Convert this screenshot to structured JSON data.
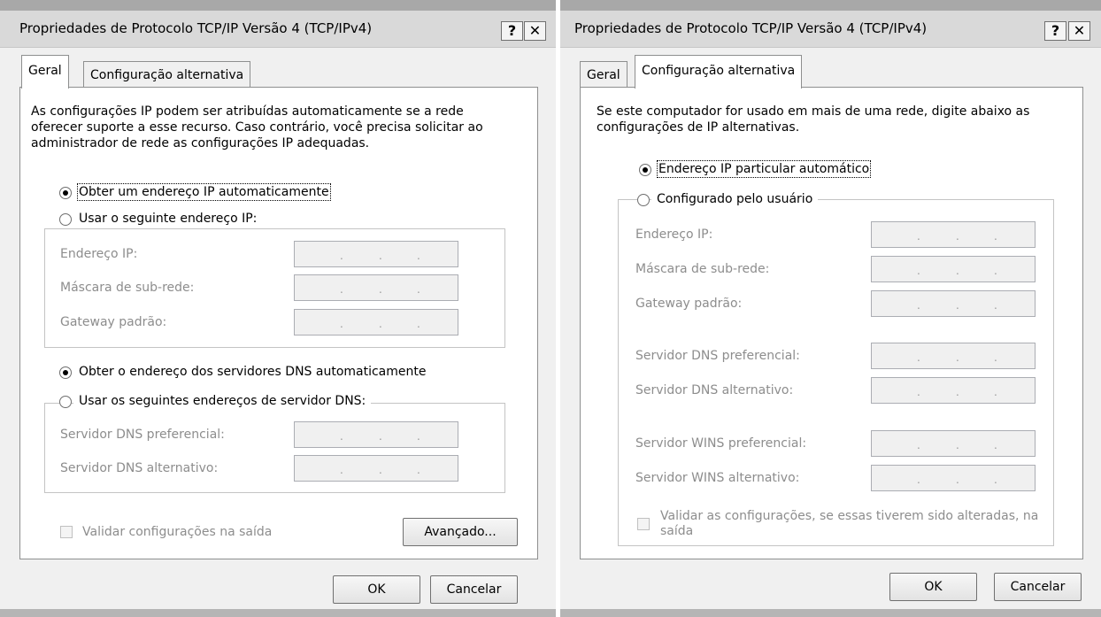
{
  "dialog_left": {
    "title": "Propriedades de Protocolo TCP/IP Versão 4 (TCP/IPv4)",
    "help_button": "?",
    "close_button": "✕",
    "tabs": [
      "Geral",
      "Configuração alternativa"
    ],
    "active_tab": "Geral",
    "intro": "As configurações IP podem ser atribuídas automaticamente se a rede oferecer suporte a esse recurso. Caso contrário, você precisa solicitar ao administrador de rede as configurações IP adequadas.",
    "radio_obtain_ip": "Obter um endereço IP automaticamente",
    "radio_use_ip": "Usar o seguinte endereço IP:",
    "ip_fields": [
      "Endereço IP:",
      "Máscara de sub-rede:",
      "Gateway padrão:"
    ],
    "radio_obtain_dns": "Obter o endereço dos servidores DNS automaticamente",
    "radio_use_dns": "Usar os seguintes endereços de servidor DNS:",
    "dns_fields": [
      "Servidor DNS preferencial:",
      "Servidor DNS alternativo:"
    ],
    "validate_checkbox": "Validar configurações na saída",
    "advanced_button": "Avançado...",
    "ok_button": "OK",
    "cancel_button": "Cancelar",
    "ip_dots": ". . ."
  },
  "dialog_right": {
    "title": "Propriedades de Protocolo TCP/IP Versão 4 (TCP/IPv4)",
    "help_button": "?",
    "close_button": "✕",
    "tabs": [
      "Geral",
      "Configuração alternativa"
    ],
    "active_tab": "Configuração alternativa",
    "intro": "Se este computador for usado em mais de uma rede, digite abaixo as configurações de IP alternativas.",
    "radio_auto_private": "Endereço IP particular automático",
    "radio_user_config": "Configurado pelo usuário",
    "fields": [
      "Endereço IP:",
      "Máscara de sub-rede:",
      "Gateway padrão:",
      "Servidor DNS preferencial:",
      "Servidor DNS alternativo:",
      "Servidor WINS preferencial:",
      "Servidor WINS alternativo:"
    ],
    "validate_checkbox": "Validar as configurações, se essas tiverem sido alteradas, na saída",
    "ok_button": "OK",
    "cancel_button": "Cancelar"
  },
  "colors": {
    "dialog_bg": "#f0f0f0",
    "panel_bg": "#ffffff",
    "disabled_text": "#8d8d8d",
    "border": "#8e8f8f"
  }
}
